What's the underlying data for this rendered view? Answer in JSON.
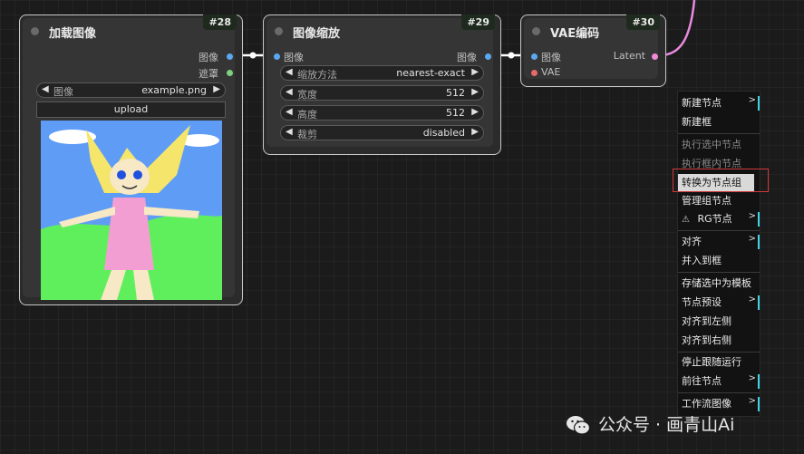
{
  "nodes": {
    "load_image": {
      "id": "#28",
      "title": "加载图像",
      "outputs": [
        "图像",
        "遮罩"
      ],
      "image_widget": {
        "label": "图像",
        "value": "example.png"
      },
      "upload_label": "upload"
    },
    "scale_image": {
      "id": "#29",
      "title": "图像缩放",
      "input": "图像",
      "output": "图像",
      "widgets": [
        {
          "label": "缩放方法",
          "value": "nearest-exact"
        },
        {
          "label": "宽度",
          "value": "512"
        },
        {
          "label": "高度",
          "value": "512"
        },
        {
          "label": "裁剪",
          "value": "disabled"
        }
      ]
    },
    "vae_encode": {
      "id": "#30",
      "title": "VAE编码",
      "inputs": [
        "图像",
        "VAE"
      ],
      "output": "Latent"
    }
  },
  "context_menu": [
    {
      "label": "新建节点",
      "submenu": true
    },
    {
      "label": "新建框"
    },
    {
      "separator": true
    },
    {
      "label": "执行选中节点",
      "disabled": true
    },
    {
      "label": "执行框内节点",
      "disabled": true
    },
    {
      "label": "转换为节点组",
      "highlighted": true
    },
    {
      "label": "管理组节点"
    },
    {
      "label": "RG节点",
      "submenu": true,
      "icon": "rg-logo-icon"
    },
    {
      "separator": true
    },
    {
      "label": "对齐",
      "submenu": true
    },
    {
      "label": "并入到框"
    },
    {
      "separator": true
    },
    {
      "label": "存储选中为模板"
    },
    {
      "label": "节点预设",
      "submenu": true
    },
    {
      "label": "对齐到左侧"
    },
    {
      "label": "对齐到右侧"
    },
    {
      "separator": true
    },
    {
      "label": "停止跟随运行"
    },
    {
      "label": "前往节点",
      "submenu": true
    },
    {
      "separator": true
    },
    {
      "label": "工作流图像",
      "submenu": true
    }
  ],
  "watermark": "公众号 · 画青山Ai",
  "colors": {
    "image_slot": "#5aa9f0",
    "mask_slot": "#7fd07f",
    "vae_slot": "#e86a6a",
    "latent_slot": "#f08ad8",
    "link_white": "#ffffff",
    "link_pink": "#e98be0",
    "highlight_border": "#d23a3a",
    "submenu_marker": "#3fd3e8"
  }
}
